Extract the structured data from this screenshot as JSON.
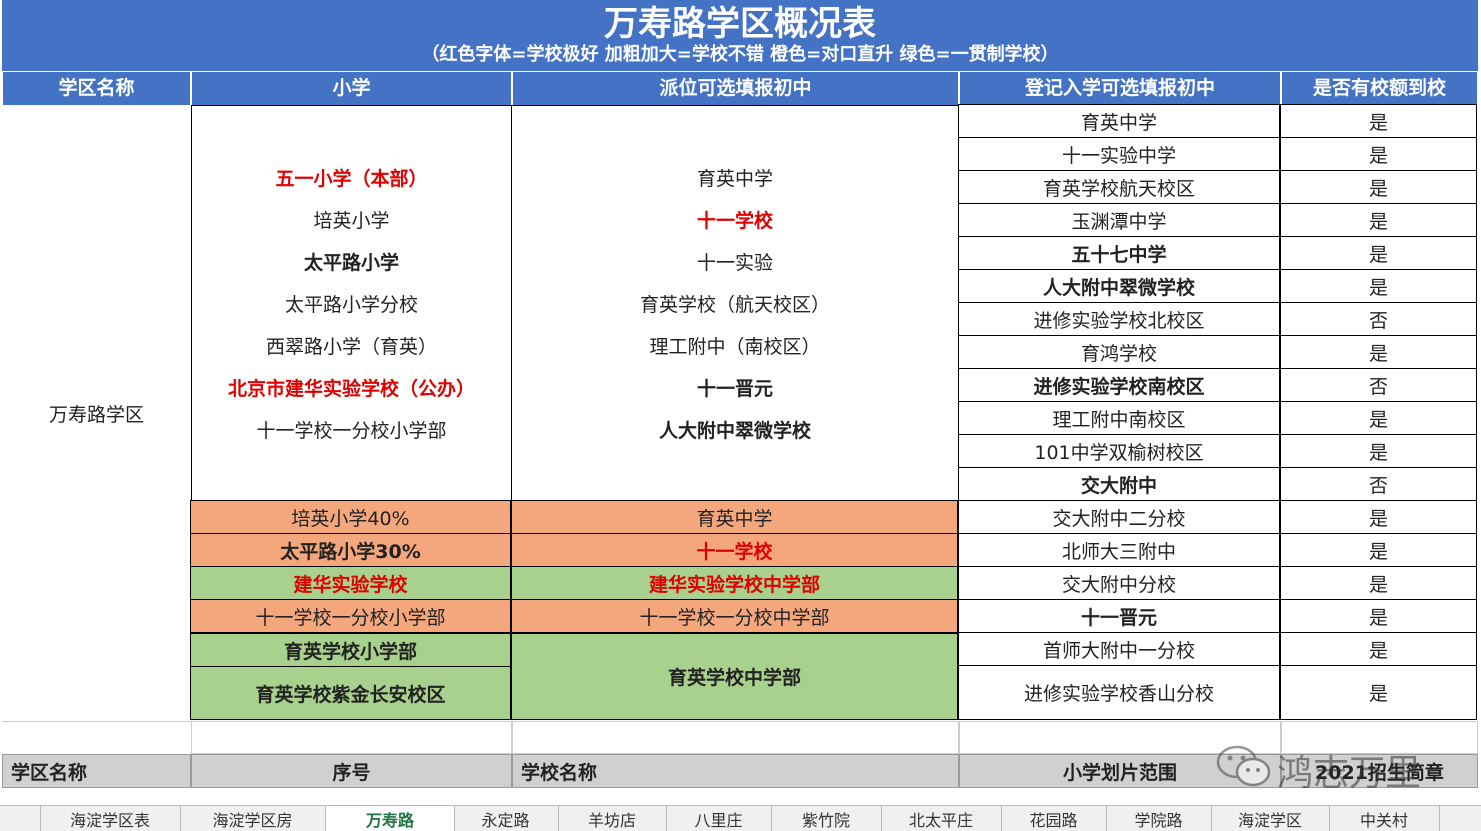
{
  "title": "万寿路学区概况表",
  "subtitle": "（红色字体=学校极好 加粗加大=学校不错 橙色=对口直升 绿色=一贯制学校）",
  "headers": [
    "学区名称",
    "小学",
    "派位可选填报初中",
    "登记入学可选填报初中",
    "是否有校额到校"
  ],
  "district": "万寿路学区",
  "primary_list": [
    {
      "text": "五一小学（本部）",
      "style": "red"
    },
    {
      "text": "培英小学",
      "style": "normal"
    },
    {
      "text": "太平路小学",
      "style": "bold"
    },
    {
      "text": "太平路小学分校",
      "style": "normal"
    },
    {
      "text": "西翠路小学（育英）",
      "style": "normal"
    },
    {
      "text": "北京市建华实验学校（公办）",
      "style": "red"
    },
    {
      "text": "十一学校一分校小学部",
      "style": "normal"
    }
  ],
  "lottery_list": [
    {
      "text": "育英中学",
      "style": "normal"
    },
    {
      "text": "十一学校",
      "style": "red"
    },
    {
      "text": "十一实验",
      "style": "normal"
    },
    {
      "text": "育英学校（航天校区）",
      "style": "normal"
    },
    {
      "text": "理工附中（南校区）",
      "style": "normal"
    },
    {
      "text": "十一晋元",
      "style": "bold"
    },
    {
      "text": "人大附中翠微学校",
      "style": "bold"
    }
  ],
  "pairs": [
    {
      "primary": "培英小学40%",
      "middle": "育英中学",
      "color": "orange",
      "pstyle": "normal",
      "mstyle": "normal"
    },
    {
      "primary": "太平路小学30%",
      "middle": "十一学校",
      "color": "orange",
      "pstyle": "bold",
      "mstyle": "red"
    },
    {
      "primary": "建华实验学校",
      "middle": "建华实验学校中学部",
      "color": "green",
      "pstyle": "red",
      "mstyle": "red"
    },
    {
      "primary": "十一学校一分校小学部",
      "middle": "十一学校一分校中学部",
      "color": "orange",
      "pstyle": "normal",
      "mstyle": "normal"
    }
  ],
  "yuying": {
    "primary1": "育英学校小学部",
    "primary2": "育英学校紫金长安校区",
    "middle": "育英学校中学部"
  },
  "registration": [
    {
      "name": "育英中学",
      "quota": "是",
      "bold": false
    },
    {
      "name": "十一实验中学",
      "quota": "是",
      "bold": false
    },
    {
      "name": "育英学校航天校区",
      "quota": "是",
      "bold": false
    },
    {
      "name": "玉渊潭中学",
      "quota": "是",
      "bold": false
    },
    {
      "name": "五十七中学",
      "quota": "是",
      "bold": true
    },
    {
      "name": "人大附中翠微学校",
      "quota": "是",
      "bold": true
    },
    {
      "name": "进修实验学校北校区",
      "quota": "否",
      "bold": false
    },
    {
      "name": "育鸿学校",
      "quota": "是",
      "bold": false
    },
    {
      "name": "进修实验学校南校区",
      "quota": "否",
      "bold": true
    },
    {
      "name": "理工附中南校区",
      "quota": "是",
      "bold": false
    },
    {
      "name": "101中学双榆树校区",
      "quota": "是",
      "bold": false
    },
    {
      "name": "交大附中",
      "quota": "否",
      "bold": true
    },
    {
      "name": "交大附中二分校",
      "quota": "是",
      "bold": false
    },
    {
      "name": "北师大三附中",
      "quota": "是",
      "bold": false
    },
    {
      "name": "交大附中分校",
      "quota": "是",
      "bold": false
    },
    {
      "name": "十一晋元",
      "quota": "是",
      "bold": true
    },
    {
      "name": "首师大附中一分校",
      "quota": "是",
      "bold": false
    },
    {
      "name": "进修实验学校香山分校",
      "quota": "是",
      "bold": false
    }
  ],
  "second_header": {
    "a": "学区名称",
    "b": "序号",
    "c": "学校名称",
    "d": "小学划片范围",
    "e": "2021招生简章"
  },
  "watermark": "鸿志万里",
  "tabs": [
    "",
    "海淀学区表",
    "海淀学区房",
    "万寿路",
    "永定路",
    "羊坊店",
    "八里庄",
    "紫竹院",
    "北太平庄",
    "花园路",
    "学院路",
    "海淀学区",
    "中关村"
  ],
  "active_tab": 3,
  "colors": {
    "header": "#4472c4",
    "orange": "#f4a77c",
    "green": "#a9d18e",
    "red": "#e00000",
    "gray": "#d0d0d0"
  }
}
